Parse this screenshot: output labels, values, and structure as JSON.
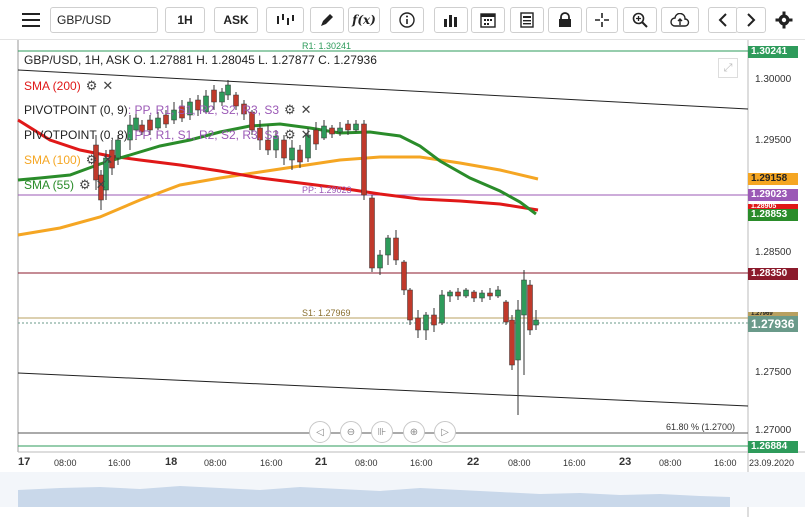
{
  "toolbar": {
    "symbol": "GBP/USD",
    "timeframe": "1H",
    "price_side": "ASK",
    "fx_label": "f(x)"
  },
  "header": {
    "info": "GBP/USD, 1H, ASK   O. 1.27881 H. 1.28045 L. 1.27877 C. 1.27936"
  },
  "indicators": {
    "sma200": "SMA (200)",
    "pivot1_prefix": "PIVOTPOINT (0, 9)",
    "pivot1_levels": ": PP, R1, S1, R2, S2, R3, S3",
    "pivot2_prefix": "PIVOTPOINT (0, 8)",
    "pivot2_levels": ": PP, R1, S1, R2, S2, R3, S3",
    "sma100": "SMA (100)",
    "sma55": "SMA (55)"
  },
  "chart_lines": {
    "r1": "R1: 1.30241",
    "pp": "PP: 1.29023",
    "s1": "S1: 1.27969",
    "fib": "61.80 % (1.2700)"
  },
  "price_labels": {
    "r1": "1.30241",
    "sma100": "1.29158",
    "pp": "1.29023",
    "sma200": "1.28905",
    "sma55": "1.28853",
    "red_line": "1.28350",
    "s1": "1.27969",
    "current": "1.27936",
    "bottom": "1.26884"
  },
  "y_axis": [
    "1.30000",
    "1.29500",
    "1.29000",
    "1.28500",
    "1.28000",
    "1.27500",
    "1.27000"
  ],
  "x_axis": [
    "17",
    "08:00",
    "16:00",
    "18",
    "08:00",
    "16:00",
    "21",
    "08:00",
    "16:00",
    "22",
    "08:00",
    "16:00",
    "23",
    "08:00",
    "16:00",
    "23.09.2020"
  ],
  "colors": {
    "candle_up": "#2e9b5b",
    "candle_down": "#c0392b",
    "sma200": "#e01818",
    "sma100": "#f5a623",
    "sma55": "#2a8c2a",
    "pp": "#9b59b6",
    "red_line": "#8b1a2b",
    "r1": "#2e9b5b"
  }
}
